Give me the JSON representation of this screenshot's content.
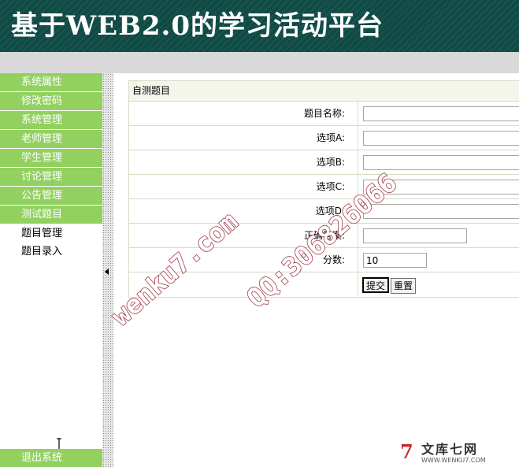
{
  "header": {
    "title": "基于WEB2.0的学习活动平台"
  },
  "sidebar": {
    "menu": [
      {
        "label": "系统属性"
      },
      {
        "label": "修改密码"
      },
      {
        "label": "系统管理"
      },
      {
        "label": "老师管理"
      },
      {
        "label": "学生管理"
      },
      {
        "label": "讨论管理"
      },
      {
        "label": "公告管理"
      },
      {
        "label": "测试题目"
      }
    ],
    "submenu": [
      {
        "label": "题目管理"
      },
      {
        "label": "题目录入"
      }
    ],
    "logout": "退出系统"
  },
  "form": {
    "title": "自测题目",
    "fields": [
      {
        "label": "题目名称:",
        "value": ""
      },
      {
        "label": "选项A:",
        "value": ""
      },
      {
        "label": "选项B:",
        "value": ""
      },
      {
        "label": "选项C:",
        "value": ""
      },
      {
        "label": "选项D:",
        "value": ""
      },
      {
        "label": "正确答案:",
        "value": ""
      },
      {
        "label": "分数:",
        "value": "10"
      }
    ],
    "submit_label": "提交",
    "reset_label": "重置"
  },
  "watermark": {
    "site": "wenku7.com",
    "qq": "QQ:306826066"
  },
  "brand": {
    "mark": "7",
    "name": "文库七网",
    "url": "WWW.WENKU7.COM"
  },
  "colors": {
    "header_bg": "#0f4a45",
    "menu_green": "#92d160",
    "watermark_red": "#a0394a"
  },
  "icons": [
    "cursor-icon",
    "collapse-arrow-icon"
  ]
}
